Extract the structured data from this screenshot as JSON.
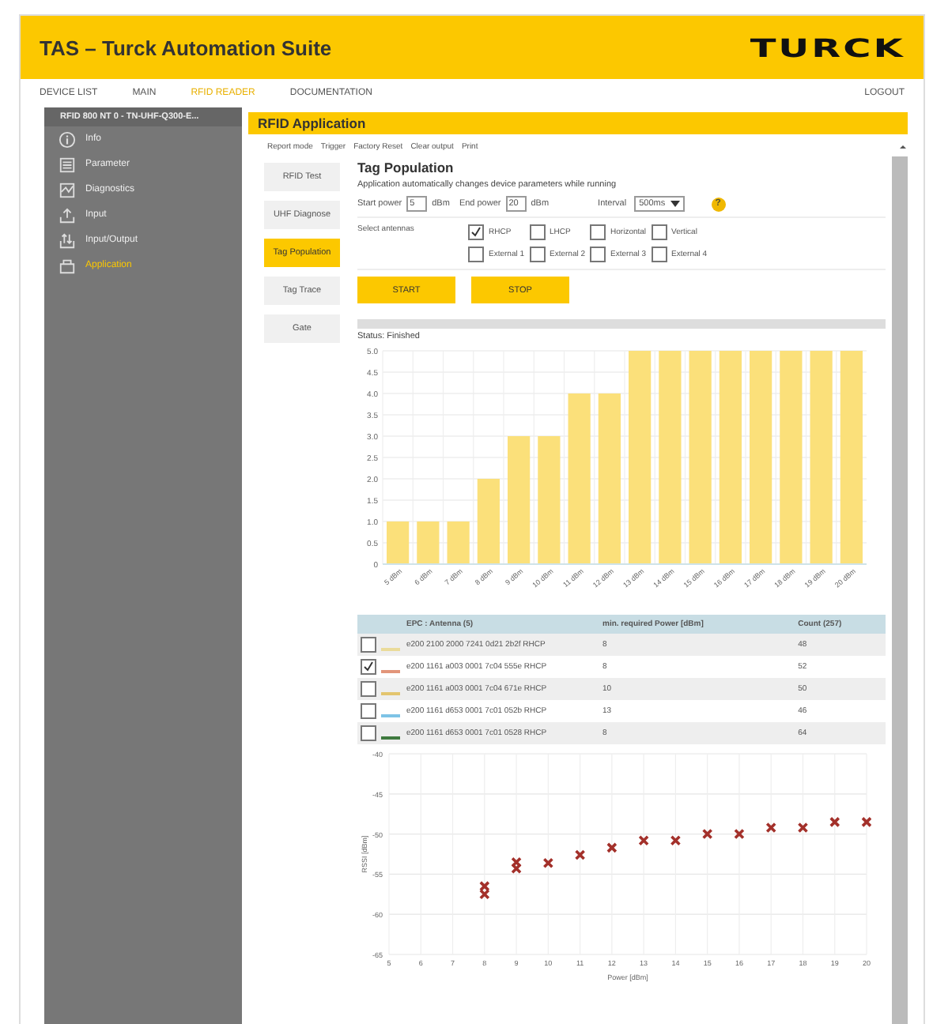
{
  "header": {
    "title": "TAS – Turck Automation Suite",
    "logo": "TURCK"
  },
  "nav": {
    "items": [
      {
        "label": "DEVICE LIST",
        "selected": false
      },
      {
        "label": "MAIN",
        "selected": false
      },
      {
        "label": "RFID READER",
        "selected": true
      },
      {
        "label": "DOCUMENTATION",
        "selected": false
      }
    ],
    "logout": "LOGOUT"
  },
  "sidebar": {
    "device": "RFID 800 NT 0 - TN-UHF-Q300-E...",
    "items": [
      {
        "label": "Info",
        "kind": "info",
        "selected": false
      },
      {
        "label": "Parameter",
        "kind": "parameter",
        "selected": false
      },
      {
        "label": "Diagnostics",
        "kind": "diagnostics",
        "selected": false
      },
      {
        "label": "Input",
        "kind": "input",
        "selected": false
      },
      {
        "label": "Input/Output",
        "kind": "inout",
        "selected": false
      },
      {
        "label": "Application",
        "kind": "application",
        "selected": true
      }
    ]
  },
  "page_title": "RFID Application",
  "toolbar": [
    "Report mode",
    "Trigger",
    "Factory Reset",
    "Clear output",
    "Print"
  ],
  "subtabs": [
    {
      "label": "RFID Test",
      "selected": false
    },
    {
      "label": "UHF Diagnose",
      "selected": false
    },
    {
      "label": "Tag Population",
      "selected": true
    },
    {
      "label": "Tag Trace",
      "selected": false
    },
    {
      "label": "Gate",
      "selected": false
    }
  ],
  "panel": {
    "title": "Tag Population",
    "description": "Application automatically changes device parameters while running"
  },
  "form": {
    "start_label": "Start power",
    "start_value": "5",
    "start_unit": "dBm",
    "end_label": "End power",
    "end_value": "20",
    "end_unit": "dBm",
    "interval_label": "Interval",
    "interval_value": "500ms",
    "help": "?",
    "antennas_label": "Select antennas",
    "antennas": [
      {
        "label": "RHCP",
        "checked": true
      },
      {
        "label": "LHCP",
        "checked": false
      },
      {
        "label": "Horizontal",
        "checked": false
      },
      {
        "label": "Vertical",
        "checked": false
      },
      {
        "label": "External 1",
        "checked": false
      },
      {
        "label": "External 2",
        "checked": false
      },
      {
        "label": "External 3",
        "checked": false
      },
      {
        "label": "External 4",
        "checked": false
      }
    ]
  },
  "buttons": [
    "START",
    "STOP"
  ],
  "status": "Status: Finished",
  "bar_chart": {
    "chart_data": {
      "type": "bar",
      "categories": [
        "5 dBm",
        "6 dBm",
        "7 dBm",
        "8 dBm",
        "9 dBm",
        "10 dBm",
        "11 dBm",
        "12 dBm",
        "13 dBm",
        "14 dBm",
        "15 dBm",
        "16 dBm",
        "17 dBm",
        "18 dBm",
        "19 dBm",
        "20 dBm"
      ],
      "grid": true,
      "series": [
        {
          "color": "#fbe07a",
          "values": [
            1,
            1,
            1,
            2,
            3,
            3,
            4,
            4,
            5,
            5,
            5,
            5,
            5,
            5,
            5,
            5
          ]
        }
      ],
      "ylim": [
        0,
        5
      ],
      "yticks": [
        {
          "value": 0,
          "label": "0"
        },
        {
          "value": 0.5,
          "label": "0.5"
        },
        {
          "value": 1,
          "label": "1.0"
        },
        {
          "value": 1.5,
          "label": "1.5"
        },
        {
          "value": 2,
          "label": "2.0"
        },
        {
          "value": 2.5,
          "label": "2.5"
        },
        {
          "value": 3,
          "label": "3.0"
        },
        {
          "value": 3.5,
          "label": "3.5"
        },
        {
          "value": 4,
          "label": "4.0"
        },
        {
          "value": 4.5,
          "label": "4.5"
        },
        {
          "value": 5,
          "label": "5.0"
        }
      ]
    }
  },
  "table": {
    "columns": [
      "EPC : Antenna (5)",
      "min. required Power [dBm]",
      "Count (257)"
    ],
    "rows": [
      {
        "checked": false,
        "color": "#eadb9a",
        "cells": [
          "e200 2100 2000 7241 0d21 2b2f RHCP",
          "8",
          "48"
        ]
      },
      {
        "checked": true,
        "color": "#e2957a",
        "cells": [
          "e200 1161 a003 0001 7c04 555e RHCP",
          "8",
          "52"
        ]
      },
      {
        "checked": false,
        "color": "#e3c56e",
        "cells": [
          "e200 1161 a003 0001 7c04 671e RHCP",
          "10",
          "50"
        ]
      },
      {
        "checked": false,
        "color": "#7ec3e6",
        "cells": [
          "e200 1161 d653 0001 7c01 052b RHCP",
          "13",
          "46"
        ]
      },
      {
        "checked": false,
        "color": "#3f7a3f",
        "cells": [
          "e200 1161 d653 0001 7c01 0528 RHCP",
          "8",
          "64"
        ]
      }
    ]
  },
  "scatter": {
    "chart_data": {
      "type": "scatter",
      "xlabel": "Power [dBm]",
      "ylabel": "RSSI [dBm]",
      "xlim": [
        5,
        20
      ],
      "ylim": [
        -65,
        -40
      ],
      "xticks": [
        5,
        6,
        7,
        8,
        9,
        10,
        11,
        12,
        13,
        14,
        15,
        16,
        17,
        18,
        19,
        20
      ],
      "yticks": [
        -40,
        -45,
        -50,
        -55,
        -60,
        -65
      ],
      "x": [
        8,
        8,
        9,
        9,
        10,
        11,
        12,
        13,
        14,
        15,
        16,
        17,
        18,
        19,
        20
      ],
      "grid": true,
      "series": [
        {
          "color": "#a3302a",
          "values": [
            -56.5,
            -57.5,
            -53.5,
            -54.3,
            -53.6,
            -52.6,
            -51.7,
            -50.8,
            -50.8,
            -50,
            -50,
            -49.2,
            -49.2,
            -48.5,
            -48.5
          ]
        }
      ]
    }
  }
}
